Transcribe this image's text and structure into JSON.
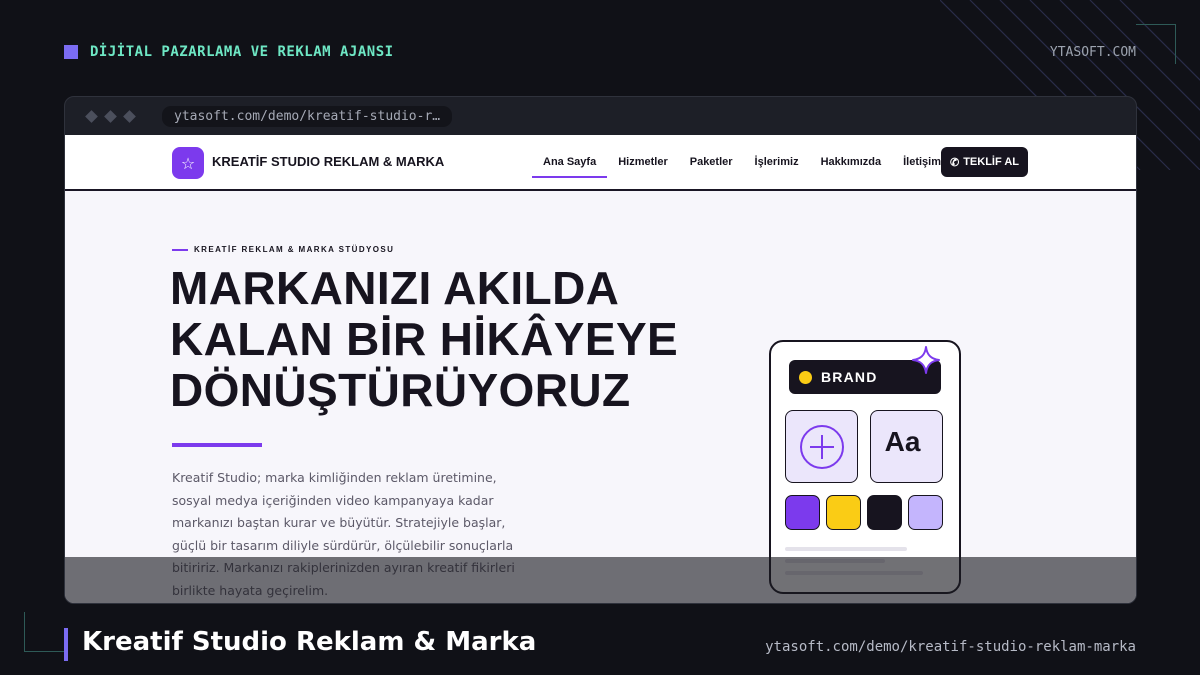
{
  "top": {
    "tag": "DİJİTAL PAZARLAMA VE REKLAM AJANSI",
    "domain": "YTASOFT.COM"
  },
  "browser": {
    "url": "ytasoft.com/demo/kreatif-studio-r…"
  },
  "site": {
    "logo_text": "KREATİF STUDIO REKLAM & MARKA",
    "nav": [
      {
        "label": "Ana Sayfa",
        "active": true
      },
      {
        "label": "Hizmetler",
        "active": false
      },
      {
        "label": "Paketler",
        "active": false
      },
      {
        "label": "İşlerimiz",
        "active": false
      },
      {
        "label": "Hakkımızda",
        "active": false
      },
      {
        "label": "İletişim",
        "active": false
      }
    ],
    "cta_label": "TEKLİF AL"
  },
  "hero": {
    "eyebrow": "KREATİF REKLAM & MARKA STÜDYOSU",
    "title_lines": [
      "MARKANIZI AKILDA",
      "KALAN BİR HİKÂYEYE",
      "DÖNÜŞTÜRÜYORUZ"
    ],
    "description": "Kreatif Studio; marka kimliğinden reklam üretimine, sosyal medya içeriğinden video kampanyaya kadar markanızı baştan kurar ve büyütür. Stratejiyle başlar, güçlü bir tasarım diliyle sürdürür, ölçülebilir sonuçlarla bitiririz. Markanızı rakiplerinizden ayıran kreatif fikirleri birlikte hayata geçirelim."
  },
  "card": {
    "label": "BRAND",
    "tile_text": "Aa",
    "swatches": [
      "#7c3aed",
      "#facc15",
      "#17141f",
      "#c4b5fd"
    ],
    "accent": "#7c3aed"
  },
  "footer": {
    "title": "Kreatif Studio Reklam & Marka",
    "url": "ytasoft.com/demo/kreatif-studio-reklam-marka"
  }
}
